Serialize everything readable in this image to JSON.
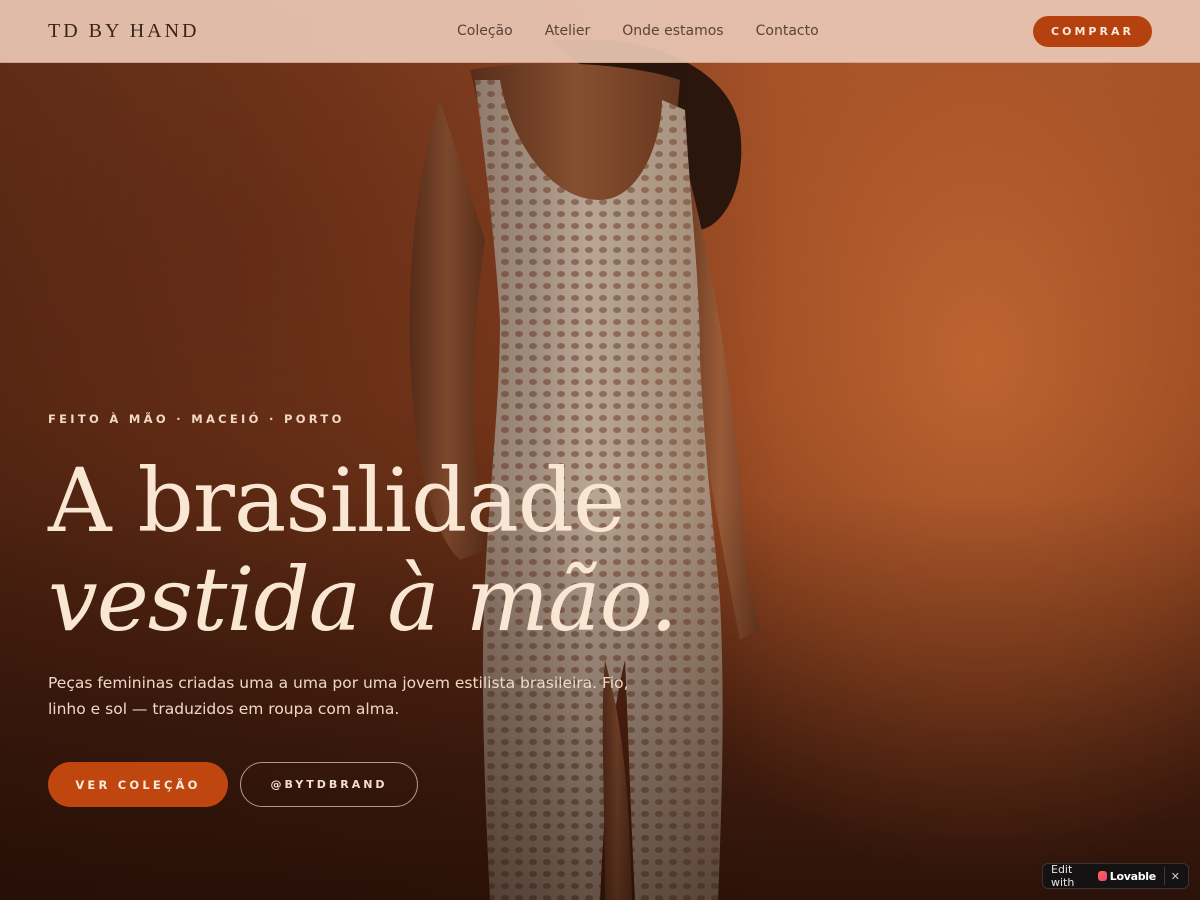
{
  "header": {
    "brand": "TD BY HAND",
    "nav": [
      {
        "label": "Coleção"
      },
      {
        "label": "Atelier"
      },
      {
        "label": "Onde estamos"
      },
      {
        "label": "Contacto"
      }
    ],
    "buy_label": "COMPRAR"
  },
  "hero": {
    "eyebrow": "FEITO À MÃO · MACEIÓ · PORTO",
    "headline_line1": "A brasilidade",
    "headline_line2": "vestida à mão.",
    "lede": "Peças femininas criadas uma a uma por uma jovem estilista brasileira. Fio, linho e sol — traduzidos em roupa com alma.",
    "cta_primary": "VER COLEÇÃO",
    "cta_secondary": "@BYTDBRAND"
  },
  "badge": {
    "prefix": "Edit with",
    "brand": "Lovable",
    "close": "✕"
  },
  "colors": {
    "accent": "#c0460f",
    "header_bg": "#e8c6b4",
    "headline": "#f9e6d3"
  }
}
